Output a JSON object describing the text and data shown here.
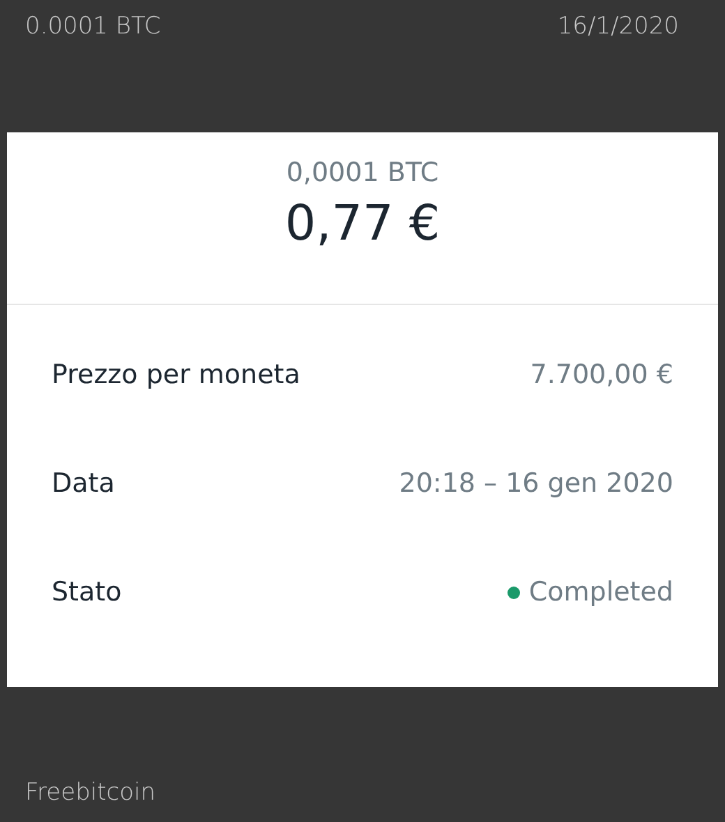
{
  "top_bar": {
    "amount": "0.0001 BTC",
    "date": "16/1/2020"
  },
  "card": {
    "crypto_amount": "0,0001 BTC",
    "fiat_amount": "0,77 €",
    "rows": [
      {
        "kind": "text",
        "label": "Prezzo per moneta",
        "value": "7.700,00 €"
      },
      {
        "kind": "text",
        "label": "Data",
        "value": "20:18 – 16 gen 2020"
      },
      {
        "kind": "status",
        "label": "Stato",
        "value": "Completed",
        "color": "#1a9a6a"
      }
    ]
  },
  "footer": {
    "source": "Freebitcoin"
  }
}
